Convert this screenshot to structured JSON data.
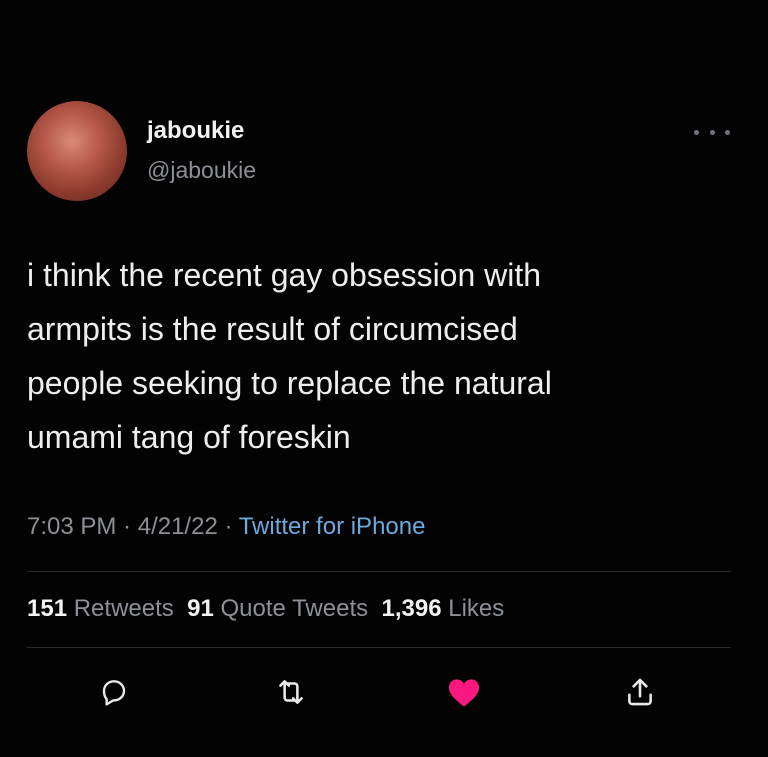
{
  "author": {
    "display_name": "jaboukie",
    "handle": "@jaboukie",
    "avatar_icon": "avatar-photo"
  },
  "more_icon": "more-options-icon",
  "tweet": {
    "text": "i think the recent gay obsession with\narmpits is the result of circumcised\npeople seeking to replace the natural\numami tang of foreskin"
  },
  "meta": {
    "time": "7:03 PM",
    "separator": " · ",
    "date": "4/21/22",
    "source": "Twitter for iPhone"
  },
  "stats": {
    "retweets_count": "151",
    "retweets_label": "Retweets",
    "quote_count": "91",
    "quote_label": "Quote Tweets",
    "likes_count": "1,396",
    "likes_label": "Likes"
  },
  "actions": {
    "reply_icon": "reply-icon",
    "retweet_icon": "retweet-icon",
    "like_icon": "heart-icon",
    "share_icon": "share-icon",
    "liked": true
  },
  "colors": {
    "background": "#030303",
    "link": "#6ea8de",
    "like": "#f91880",
    "muted": "#8b9196"
  }
}
